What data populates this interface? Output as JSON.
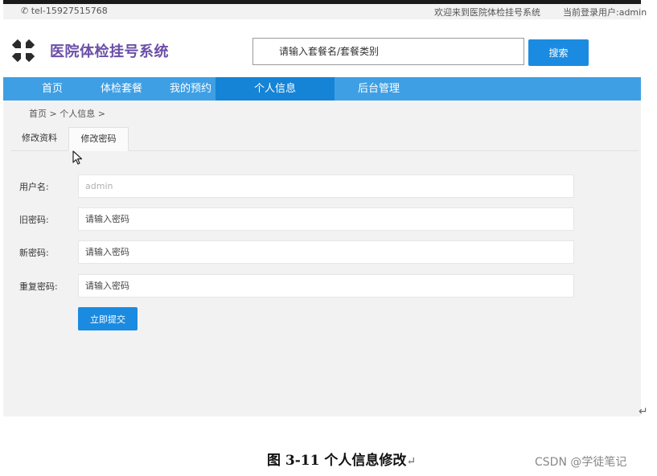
{
  "top_bar": {
    "phone": "✆ tel-15927515768",
    "welcome": "欢迎来到医院体检挂号系统",
    "current_user": "当前登录用户:admin"
  },
  "header": {
    "title": "医院体检挂号系统",
    "search_placeholder": "请输入套餐名/套餐类别",
    "search_button": "搜索"
  },
  "nav": {
    "items": [
      "首页",
      "体检套餐",
      "我的预约",
      "个人信息",
      "后台管理"
    ],
    "active": "个人信息"
  },
  "breadcrumb": "首页 > 个人信息 >",
  "tabs": [
    "修改资料",
    "修改密码"
  ],
  "active_tab": "修改密码",
  "form": {
    "username_label": "用户名:",
    "username_value": "admin",
    "old_password_label": "旧密码:",
    "old_password_placeholder": "请输入密码",
    "new_password_label": "新密码:",
    "new_password_placeholder": "请输入密码",
    "repeat_password_label": "重复密码:",
    "repeat_password_placeholder": "请输入密码",
    "submit": "立即提交"
  },
  "caption": {
    "text": "图 3-11  个人信息修改",
    "mark": "↵"
  },
  "return_mark": "↵",
  "watermark": "CSDN @学徒笔记",
  "colors": {
    "brand_title": "#6b4fa8",
    "nav_bg": "#3f9fe4",
    "nav_active": "#1583d6",
    "button": "#1a8be0"
  },
  "icons": {
    "logo": "medical-cross-icon",
    "cursor": "mouse-pointer-icon"
  }
}
